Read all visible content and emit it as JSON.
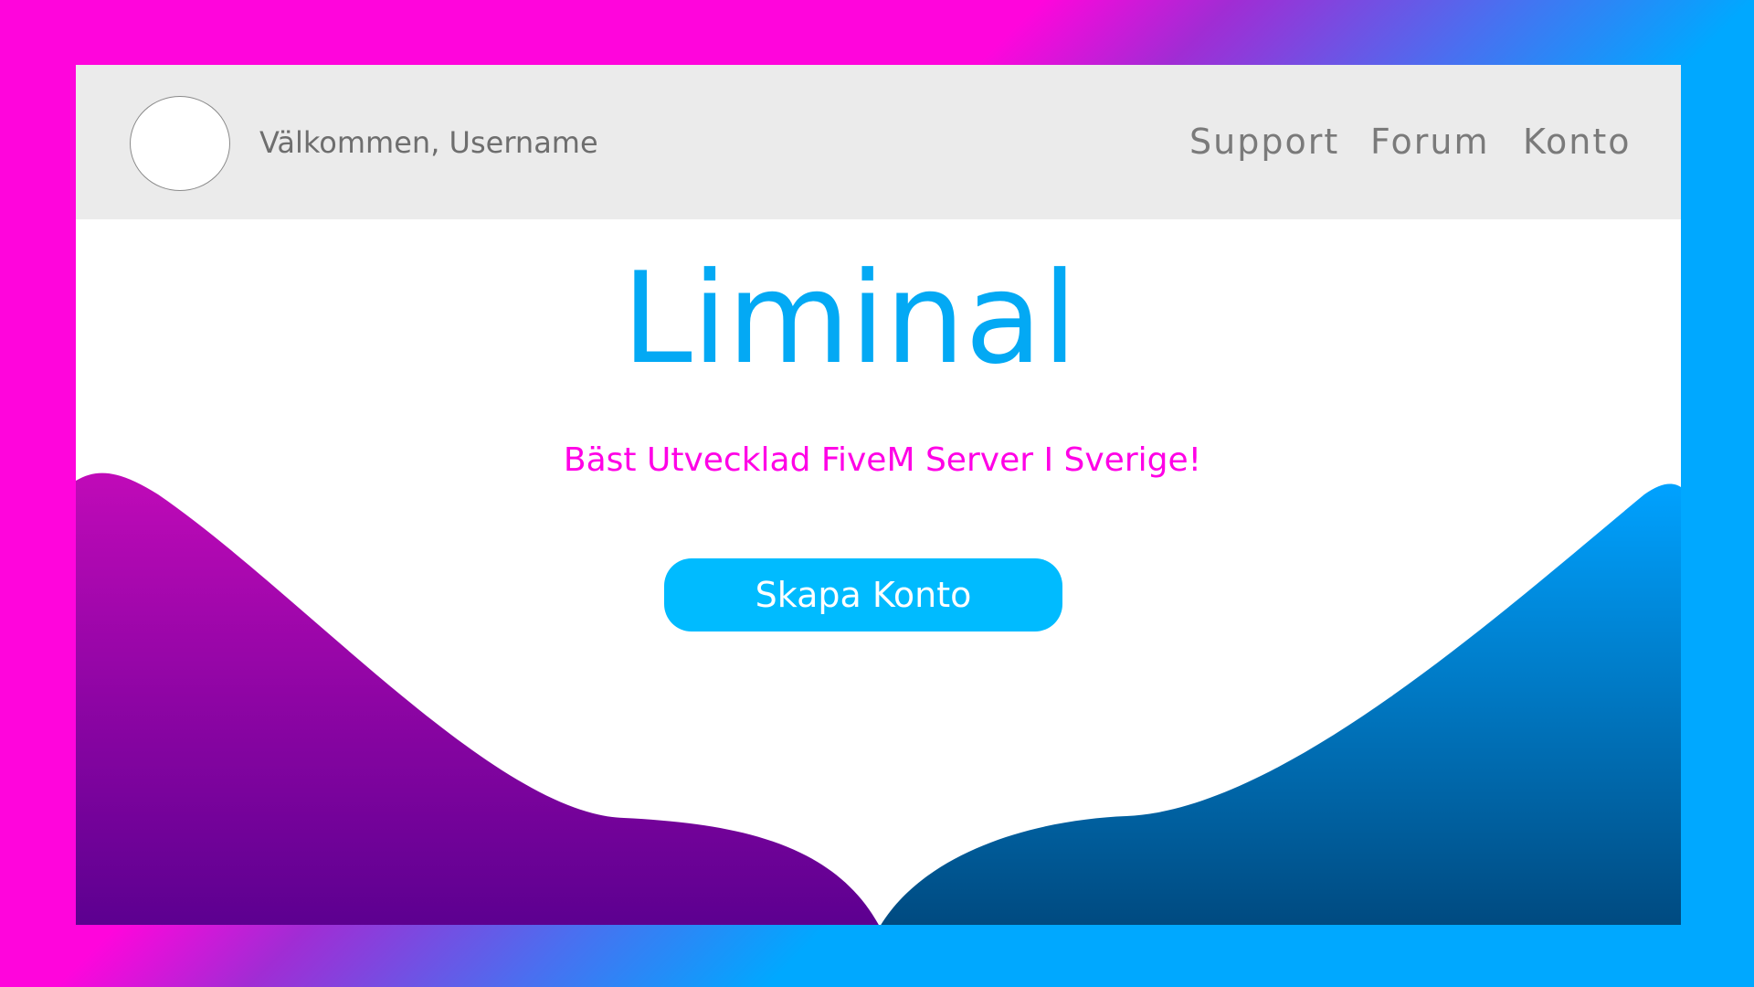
{
  "header": {
    "welcome_text": "Välkommen, Username",
    "nav": [
      {
        "label": "Support"
      },
      {
        "label": "Forum"
      },
      {
        "label": "Konto"
      }
    ]
  },
  "hero": {
    "title": "Liminal",
    "subtitle": "Bäst Utvecklad FiveM Server I Sverige!",
    "cta_label": "Skapa Konto"
  },
  "colors": {
    "background_left": "#ff05dc",
    "background_right": "#00a8ff",
    "header_bg": "#ebebeb",
    "title": "#03a9f4",
    "subtitle": "#ff00e6",
    "button": "#00bbff",
    "wave_left_top": "#c00ab8",
    "wave_left_bottom": "#5c0090",
    "wave_right_top": "#00a2ff",
    "wave_right_bottom": "#004a80"
  }
}
